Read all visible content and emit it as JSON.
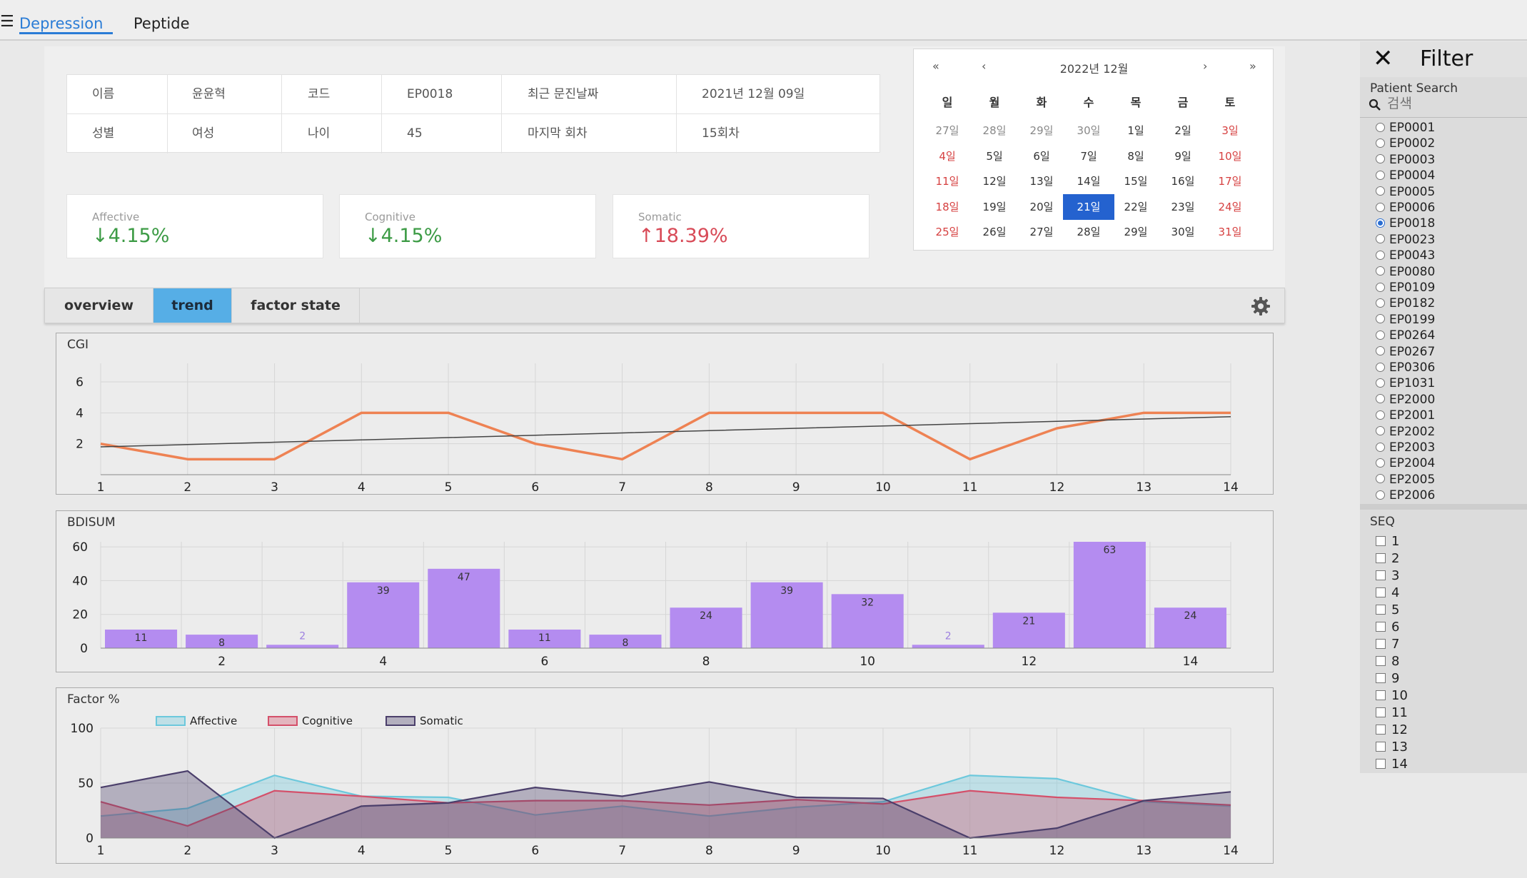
{
  "nav": {
    "menu_icon": "hamburger-icon",
    "tabs": [
      {
        "label": "Depression",
        "active": true
      },
      {
        "label": "Peptide",
        "active": false
      }
    ]
  },
  "patient_info": {
    "row1": [
      "이름",
      "윤윤혁",
      "코드",
      "EP0018",
      "최근 문진날짜",
      "2021년 12월 09일"
    ],
    "row2": [
      "성별",
      "여성",
      "나이",
      "45",
      "마지막 회차",
      "15회차"
    ]
  },
  "stats": [
    {
      "label": "Affective",
      "value": "↓4.15%",
      "direction": "down"
    },
    {
      "label": "Cognitive",
      "value": "↓4.15%",
      "direction": "down"
    },
    {
      "label": "Somatic",
      "value": "↑18.39%",
      "direction": "up"
    }
  ],
  "calendar": {
    "title": "2022년 12월",
    "nav": [
      "«",
      "‹",
      "›",
      "»"
    ],
    "weekdays": [
      "일",
      "월",
      "화",
      "수",
      "목",
      "금",
      "토"
    ],
    "weeks": [
      [
        "27일",
        "28일",
        "29일",
        "30일",
        "1일",
        "2일",
        "3일"
      ],
      [
        "4일",
        "5일",
        "6일",
        "7일",
        "8일",
        "9일",
        "10일"
      ],
      [
        "11일",
        "12일",
        "13일",
        "14일",
        "15일",
        "16일",
        "17일"
      ],
      [
        "18일",
        "19일",
        "20일",
        "21일",
        "22일",
        "23일",
        "24일"
      ],
      [
        "25일",
        "26일",
        "27일",
        "28일",
        "29일",
        "30일",
        "31일"
      ]
    ],
    "selected": "21일"
  },
  "tabs": [
    {
      "label": "overview",
      "active": false
    },
    {
      "label": "trend",
      "active": true
    },
    {
      "label": "factor state",
      "active": false
    }
  ],
  "settings_icon": "gear-icon",
  "colors": {
    "accent": "#2a7cd6",
    "tab_active": "#56aee6",
    "cgi_line": "#ee8253",
    "bar": "#b48cf0",
    "affective": "#6cc8dc",
    "cognitive": "#d4506a",
    "somatic": "#4b3f6b",
    "down": "#3c9b45",
    "up": "#d84a57"
  },
  "chart_data": [
    {
      "type": "line",
      "title": "CGI",
      "x": [
        1,
        2,
        3,
        4,
        5,
        6,
        7,
        8,
        9,
        10,
        11,
        12,
        13,
        14
      ],
      "series": [
        {
          "values": [
            2,
            1,
            1,
            4,
            4,
            2,
            1,
            4,
            4,
            4,
            1,
            3,
            4,
            4
          ]
        },
        {
          "values": [
            1.8,
            1.95,
            2.1,
            2.25,
            2.4,
            2.55,
            2.7,
            2.85,
            3.0,
            3.15,
            3.3,
            3.45,
            3.6,
            3.75
          ],
          "style": "trendline"
        }
      ],
      "y_ticks": [
        2,
        4,
        6
      ],
      "ylim": [
        0,
        7.2
      ]
    },
    {
      "type": "bar",
      "title": "BDISUM",
      "categories": [
        1,
        2,
        3,
        4,
        5,
        6,
        7,
        8,
        9,
        10,
        11,
        12,
        13,
        14
      ],
      "values": [
        11,
        8,
        2,
        39,
        47,
        11,
        8,
        24,
        39,
        32,
        2,
        21,
        63,
        24
      ],
      "x_ticks": [
        2,
        4,
        6,
        8,
        10,
        12,
        14
      ],
      "y_ticks": [
        0,
        20,
        40,
        60
      ],
      "ylim": [
        0,
        63
      ]
    },
    {
      "type": "area",
      "title": "Factor %",
      "x": [
        1,
        2,
        3,
        4,
        5,
        6,
        7,
        8,
        9,
        10,
        11,
        12,
        13,
        14
      ],
      "series": [
        {
          "name": "Affective",
          "values": [
            20,
            27,
            57,
            38,
            37,
            21,
            29,
            20,
            28,
            33,
            57,
            54,
            33,
            29
          ]
        },
        {
          "name": "Cognitive",
          "values": [
            33,
            11,
            43,
            38,
            32,
            34,
            34,
            30,
            35,
            31,
            43,
            37,
            34,
            30
          ]
        },
        {
          "name": "Somatic",
          "values": [
            46,
            61,
            0,
            29,
            32,
            46,
            38,
            51,
            37,
            36,
            0,
            9,
            34,
            42
          ]
        }
      ],
      "y_ticks": [
        0,
        50,
        100
      ],
      "ylim": [
        0,
        100
      ]
    }
  ],
  "filter": {
    "close_icon": "close-icon",
    "title": "Filter",
    "search_label": "Patient Search",
    "search_icon": "search-icon",
    "search_placeholder": "검색",
    "patients": [
      "EP0001",
      "EP0002",
      "EP0003",
      "EP0004",
      "EP0005",
      "EP0006",
      "EP0018",
      "EP0023",
      "EP0043",
      "EP0080",
      "EP0109",
      "EP0182",
      "EP0199",
      "EP0264",
      "EP0267",
      "EP0306",
      "EP1031",
      "EP2000",
      "EP2001",
      "EP2002",
      "EP2003",
      "EP2004",
      "EP2005",
      "EP2006"
    ],
    "selected_patient": "EP0018",
    "seq_label": "SEQ",
    "seq": [
      "1",
      "2",
      "3",
      "4",
      "5",
      "6",
      "7",
      "8",
      "9",
      "10",
      "11",
      "12",
      "13",
      "14"
    ]
  }
}
